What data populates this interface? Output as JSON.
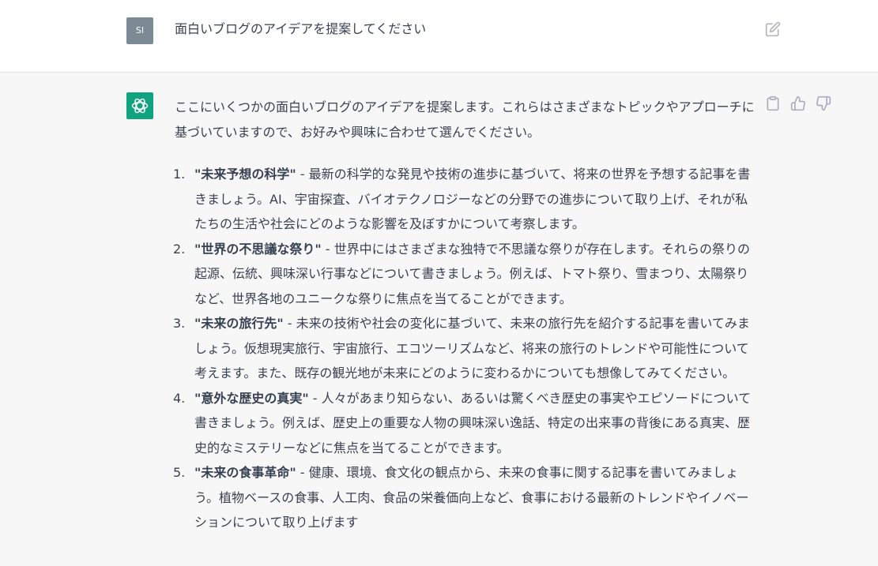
{
  "user_message": {
    "avatar_initials": "SI",
    "text": "面白いブログのアイデアを提案してください"
  },
  "assistant_message": {
    "intro": "ここにいくつかの面白いブログのアイデアを提案します。これらはさまざまなトピックやアプローチに基づいていますので、お好みや興味に合わせて選んでください。",
    "items": [
      {
        "number": "1.",
        "title": "\"未来予想の科学\"",
        "separator": " - ",
        "body": "最新の科学的な発見や技術の進歩に基づいて、将来の世界を予想する記事を書きましょう。AI、宇宙探査、バイオテクノロジーなどの分野での進歩について取り上げ、それが私たちの生活や社会にどのような影響を及ぼすかについて考察します。"
      },
      {
        "number": "2.",
        "title": "\"世界の不思議な祭り\"",
        "separator": " - ",
        "body": "世界中にはさまざまな独特で不思議な祭りが存在します。それらの祭りの起源、伝統、興味深い行事などについて書きましょう。例えば、トマト祭り、雪まつり、太陽祭りなど、世界各地のユニークな祭りに焦点を当てることができます。"
      },
      {
        "number": "3.",
        "title": "\"未来の旅行先\"",
        "separator": " - ",
        "body": "未来の技術や社会の変化に基づいて、未来の旅行先を紹介する記事を書いてみましょう。仮想現実旅行、宇宙旅行、エコツーリズムなど、将来の旅行のトレンドや可能性について考えます。また、既存の観光地が未来にどのように変わるかについても想像してみてください。"
      },
      {
        "number": "4.",
        "title": "\"意外な歴史の真実\"",
        "separator": " - ",
        "body": "人々があまり知らない、あるいは驚くべき歴史の事実やエピソードについて書きましょう。例えば、歴史上の重要な人物の興味深い逸話、特定の出来事の背後にある真実、歴史的なミステリーなどに焦点を当てることができます。"
      },
      {
        "number": "5.",
        "title": "\"未来の食事革命\"",
        "separator": " - ",
        "body": "健康、環境、食文化の観点から、未来の食事に関する記事を書いてみましょう。植物ベースの食事、人工肉、食品の栄養価向上など、食事における最新のトレンドやイノベーションについて取り上げます"
      }
    ]
  },
  "icons": {
    "edit": "edit-icon",
    "copy": "clipboard-icon",
    "thumbs_up": "thumbs-up-icon",
    "thumbs_down": "thumbs-down-icon",
    "assistant_logo": "openai-logo-icon"
  },
  "colors": {
    "assistant_avatar": "#10a37f",
    "user_avatar": "#7b8a93",
    "assistant_background": "#f7f7f8",
    "text": "#374151"
  }
}
